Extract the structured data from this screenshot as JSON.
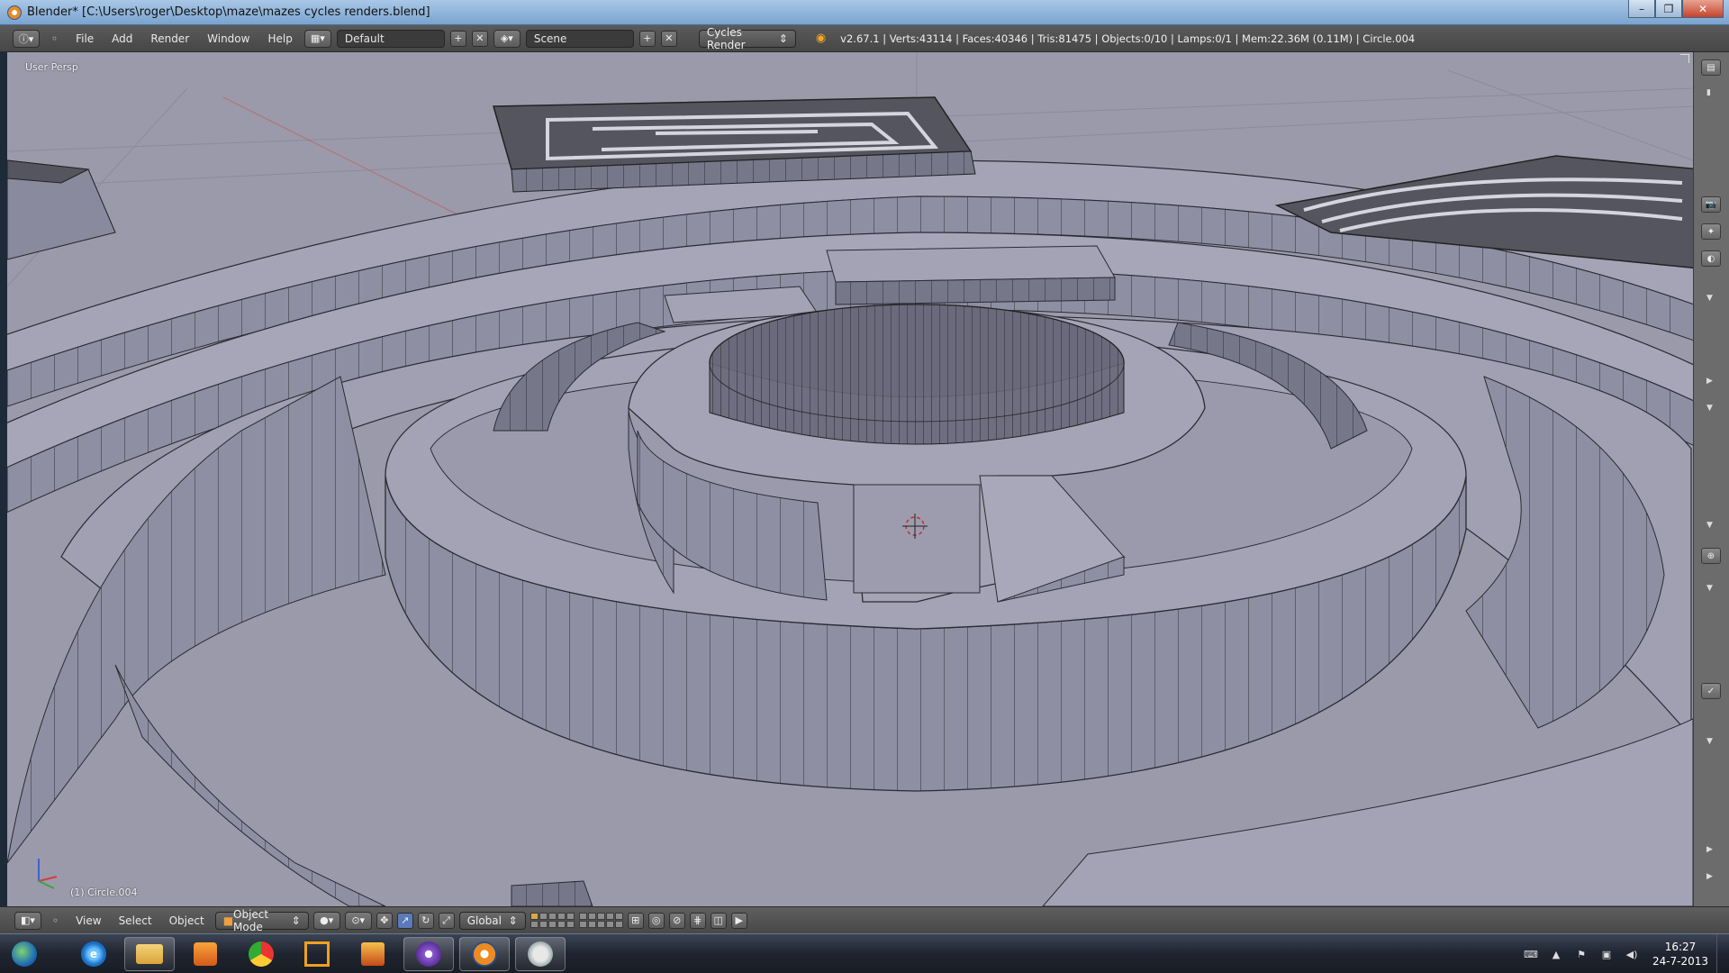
{
  "window": {
    "title": "Blender* [C:\\Users\\roger\\Desktop\\maze\\mazes cycles renders.blend]",
    "controls": [
      "–",
      "❐",
      "✕"
    ]
  },
  "info_header": {
    "menus": [
      "File",
      "Add",
      "Render",
      "Window",
      "Help"
    ],
    "screen_layout": "Default",
    "scene": "Scene",
    "render_engine": "Cycles Render",
    "stats": "v2.67.1 | Verts:43114 | Faces:40346 | Tris:81475 | Objects:0/10 | Lamps:0/1 | Mem:22.36M (0.11M) | Circle.004"
  },
  "viewport": {
    "view_label": "User Persp",
    "object_label": "(1) Circle.004",
    "colors": {
      "background": "#9c9cab",
      "wall_face": "#8e8ea2",
      "wall_dark": "#6a6a7c",
      "floor": "#a3a3b4",
      "wire": "#2b2b33"
    }
  },
  "viewport_header": {
    "menus": [
      "View",
      "Select",
      "Object"
    ],
    "mode": "Object Mode",
    "orientation": "Global"
  },
  "taskbar": {
    "apps": [
      "start-orb",
      "internet-explorer",
      "file-explorer",
      "media-player",
      "app-tile",
      "chrome",
      "office",
      "blender-launcher",
      "blender",
      "paint"
    ],
    "clock_time": "16:27",
    "clock_date": "24-7-2013"
  }
}
